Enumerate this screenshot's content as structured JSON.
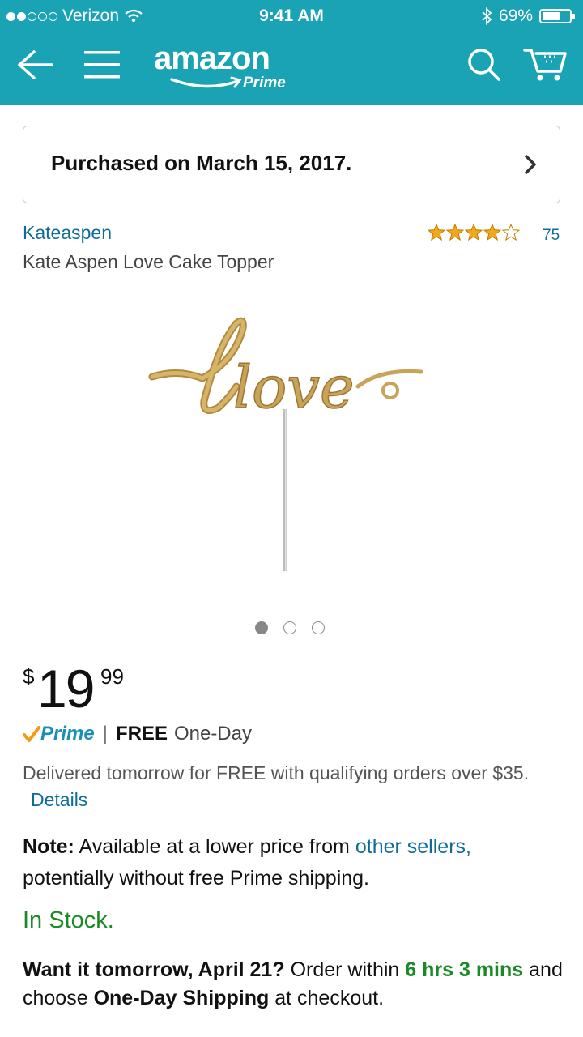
{
  "status_bar": {
    "carrier": "Verizon",
    "time": "9:41 AM",
    "battery_percent": "69%",
    "battery_level": 0.69
  },
  "nav": {
    "logo_text": "amazon",
    "logo_sub": "Prime",
    "icons": [
      "back-arrow-icon",
      "hamburger-menu-icon",
      "search-icon",
      "cart-icon"
    ]
  },
  "purchased": {
    "text": "Purchased on March 15, 2017."
  },
  "product": {
    "brand": "Kateaspen",
    "title": "Kate Aspen Love Cake Topper",
    "rating_stars": 4.5,
    "rating_count": "75",
    "image_text": "love",
    "carousel_count": 3,
    "carousel_active": 0
  },
  "price": {
    "symbol": "$",
    "whole": "19",
    "fraction": "99"
  },
  "shipping": {
    "prime_label": "Prime",
    "separator": "|",
    "free": "FREE",
    "speed": "One-Day",
    "delivered_text": "Delivered tomorrow for FREE with qualifying orders over $35.",
    "details_link": "Details"
  },
  "note": {
    "label": "Note:",
    "text_before": "Available at a lower price from",
    "link": "other sellers,",
    "text_after": "potentially without free Prime shipping."
  },
  "stock": {
    "status": "In Stock."
  },
  "want": {
    "bold_lead": "Want it tomorrow, April 21?",
    "order_within": "Order within",
    "countdown": "6 hrs 3 mins",
    "and_choose": "and choose",
    "shipping_option": "One-Day Shipping",
    "at_checkout": "at checkout."
  },
  "colors": {
    "header": "#1aa3b4",
    "link": "#0f6c9a",
    "in_stock": "#1a8a26",
    "star": "#f0a81c"
  }
}
